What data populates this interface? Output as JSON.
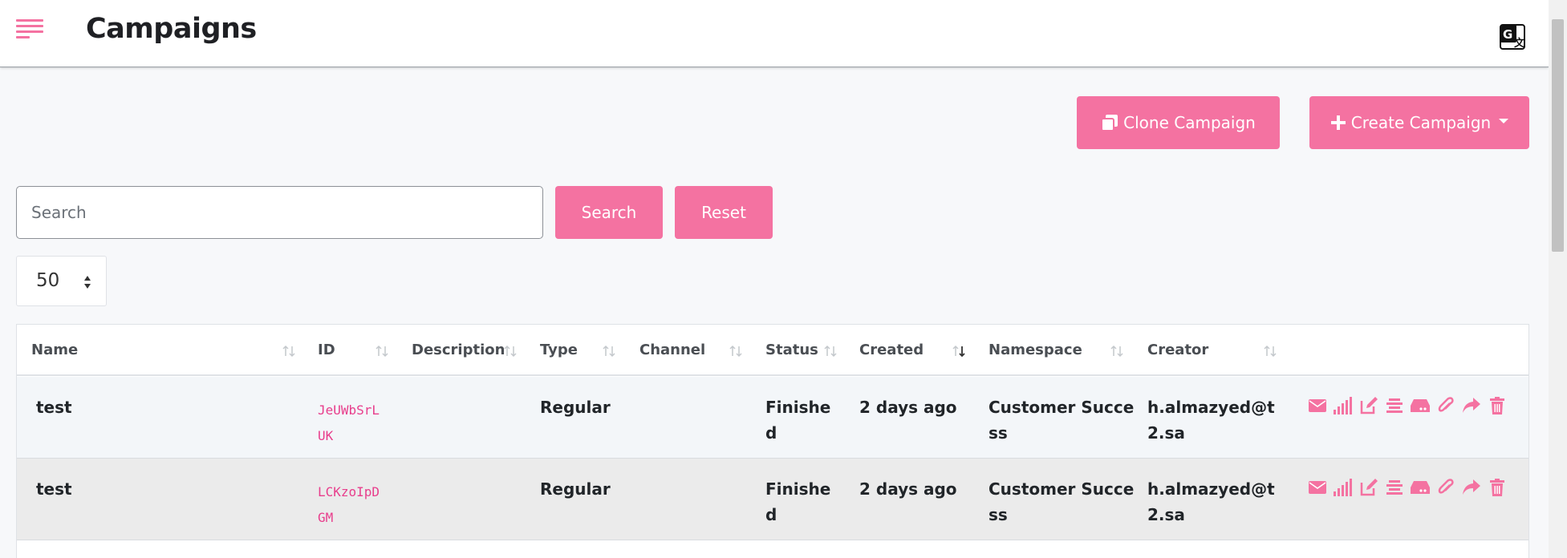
{
  "header": {
    "title": "Campaigns"
  },
  "toolbar": {
    "clone_label": "Clone Campaign",
    "create_label": "Create Campaign"
  },
  "search": {
    "placeholder": "Search",
    "value": "",
    "search_label": "Search",
    "reset_label": "Reset"
  },
  "pagination": {
    "per_page": "50"
  },
  "table": {
    "columns": [
      "Name",
      "ID",
      "Description",
      "Type",
      "Channel",
      "Status",
      "Created",
      "Namespace",
      "Creator"
    ],
    "rows": [
      {
        "name": "test",
        "id_line1": "JeUWbSrL",
        "id_line2": "UK",
        "description": "",
        "type": "Regular",
        "channel": "",
        "status_line1": "Finishe",
        "status_line2": "d",
        "created": "2 days ago",
        "namespace_line1": "Customer Succe",
        "namespace_line2": "ss",
        "creator_line1": "h.almazyed@t",
        "creator_line2": "2.sa"
      },
      {
        "name": "test",
        "id_line1": "LCKzoIpD",
        "id_line2": "GM",
        "description": "",
        "type": "Regular",
        "channel": "",
        "status_line1": "Finishe",
        "status_line2": "d",
        "created": "2 days ago",
        "namespace_line1": "Customer Succe",
        "namespace_line2": "ss",
        "creator_line1": "h.almazyed@t",
        "creator_line2": "2.sa"
      }
    ],
    "row_actions": [
      "envelope-icon",
      "signal-bars-icon",
      "edit-icon",
      "align-center-icon",
      "drive-icon",
      "paperclip-icon",
      "share-icon",
      "trash-icon"
    ],
    "sorted_column": "Created"
  },
  "colors": {
    "accent": "#f472a1",
    "id_text": "#e83e8c"
  }
}
